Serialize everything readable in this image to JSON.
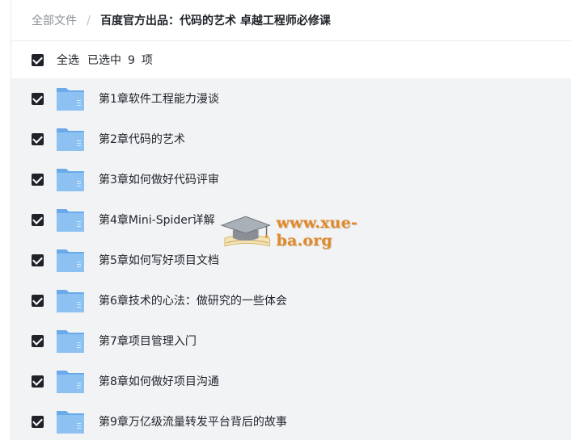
{
  "breadcrumb": {
    "root": "全部文件",
    "separator": "/",
    "current": "百度官方出品：代码的艺术 卓越工程师必修课"
  },
  "selection": {
    "select_all_label": "全选",
    "selected_prefix": "已选中",
    "selected_count": "9",
    "selected_suffix": "项"
  },
  "files": [
    {
      "name": "第1章软件工程能力漫谈",
      "checked": true,
      "icon": "folder-icon"
    },
    {
      "name": "第2章代码的艺术",
      "checked": true,
      "icon": "folder-icon"
    },
    {
      "name": "第3章如何做好代码评审",
      "checked": true,
      "icon": "folder-icon"
    },
    {
      "name": "第4章Mini-Spider详解",
      "checked": true,
      "icon": "folder-icon"
    },
    {
      "name": "第5章如何写好项目文档",
      "checked": true,
      "icon": "folder-icon"
    },
    {
      "name": "第6章技术的心法：做研究的一些体会",
      "checked": true,
      "icon": "folder-icon"
    },
    {
      "name": "第7章项目管理入门",
      "checked": true,
      "icon": "folder-icon"
    },
    {
      "name": "第8章如何做好项目沟通",
      "checked": true,
      "icon": "folder-icon"
    },
    {
      "name": "第9章万亿级流量转发平台背后的故事",
      "checked": true,
      "icon": "folder-icon"
    }
  ],
  "watermark": {
    "text": "www.xue-ba.org",
    "icon": "graduation-cap-book-icon"
  },
  "colors": {
    "list_background": "#f2f3f5",
    "checkbox": "#1f2329",
    "folder": "#7fb6ee",
    "watermark": "#e08a2a"
  }
}
